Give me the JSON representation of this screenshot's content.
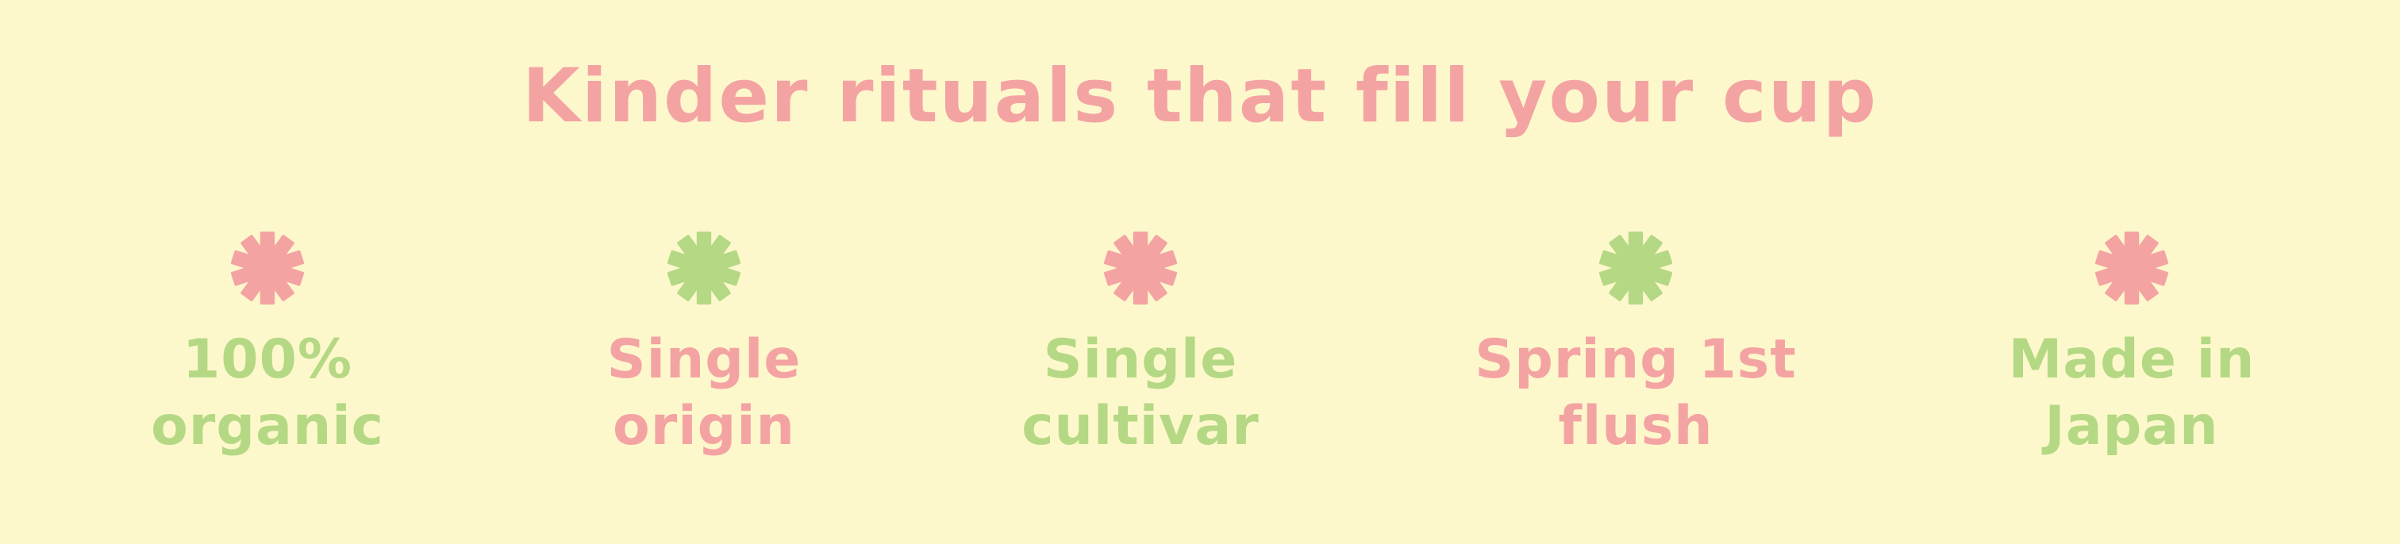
{
  "heading": "Kinder rituals that fill your cup",
  "colors": {
    "background": "#fdf8cc",
    "pink": "#f4a3a3",
    "green": "#b5d884"
  },
  "features": [
    {
      "line1": "100%",
      "line2": "organic",
      "icon": "asterisk-icon",
      "icon_color": "pink",
      "text_color": "green"
    },
    {
      "line1": "Single",
      "line2": "origin",
      "icon": "asterisk-icon",
      "icon_color": "green",
      "text_color": "pink"
    },
    {
      "line1": "Single",
      "line2": "cultivar",
      "icon": "asterisk-icon",
      "icon_color": "pink",
      "text_color": "green"
    },
    {
      "line1": "Spring 1st",
      "line2": "flush",
      "icon": "asterisk-icon",
      "icon_color": "green",
      "text_color": "pink"
    },
    {
      "line1": "Made in",
      "line2": "Japan",
      "icon": "asterisk-icon",
      "icon_color": "pink",
      "text_color": "green"
    }
  ]
}
